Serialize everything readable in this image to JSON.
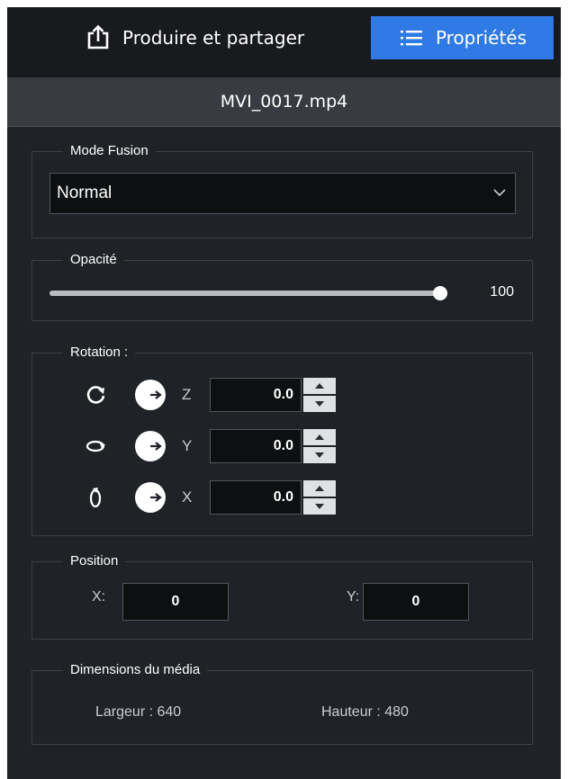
{
  "tabs": {
    "produce_label": "Produire et partager",
    "properties_label": "Propriétés",
    "produce_icon": "share-upload-icon",
    "properties_icon": "list-icon",
    "active_color": "#2f7ae5"
  },
  "file": {
    "name": "MVI_0017.mp4"
  },
  "blend": {
    "legend": "Mode Fusion",
    "value": "Normal",
    "icon": "chevron-down-icon"
  },
  "opacity": {
    "legend": "Opacité",
    "value": 100,
    "value_label": "100",
    "level": 1.0
  },
  "rotation": {
    "legend": "Rotation :",
    "rows": [
      {
        "axis": "Z",
        "value": "0.0",
        "icon": "rotate-z-icon"
      },
      {
        "axis": "Y",
        "value": "0.0",
        "icon": "rotate-y-icon"
      },
      {
        "axis": "X",
        "value": "0.0",
        "icon": "rotate-x-icon"
      }
    ],
    "dial_icon": "angle-dial-icon"
  },
  "position": {
    "legend": "Position",
    "x_label": "X:",
    "x_value": "0",
    "y_label": "Y:",
    "y_value": "0"
  },
  "dimensions": {
    "legend": "Dimensions du média",
    "width_text": "Largeur : 640",
    "height_text": "Hauteur : 480"
  }
}
